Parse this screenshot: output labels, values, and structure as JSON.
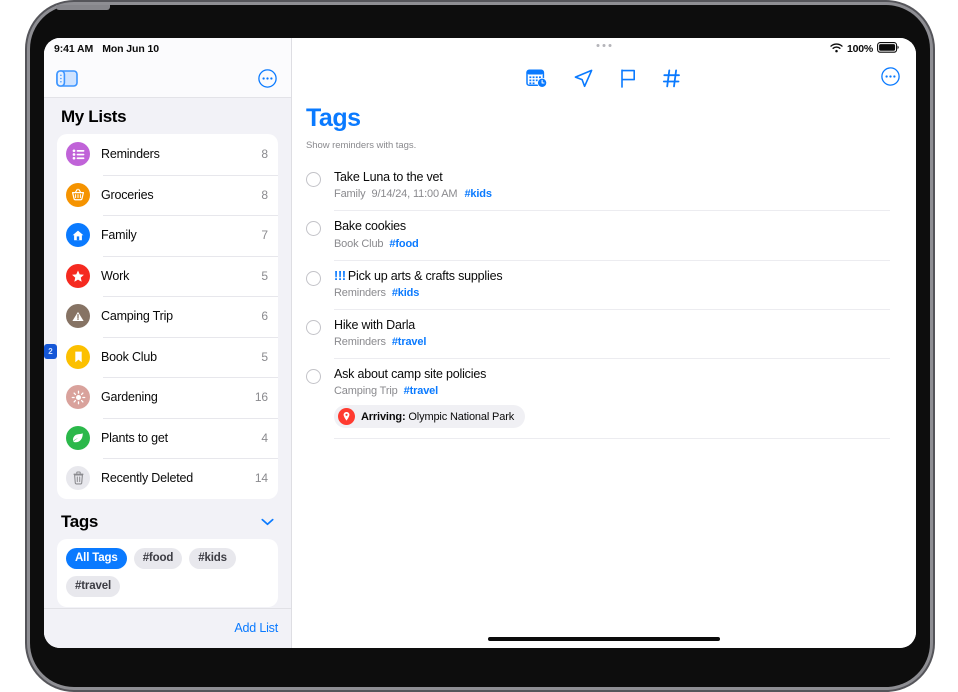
{
  "status_bar": {
    "time": "9:41 AM",
    "date": "Mon Jun 10",
    "wifi_icon": "wifi-icon",
    "battery_percent": "100%",
    "battery_icon": "battery-full-icon"
  },
  "sidebar": {
    "toggle_icon": "sidebar-toggle-icon",
    "more_icon": "more-circle-icon",
    "title": "My Lists",
    "lists": [
      {
        "label": "Reminders",
        "count": "8",
        "icon": "list-bullet-icon",
        "color": "#c063d8"
      },
      {
        "label": "Groceries",
        "count": "8",
        "icon": "basket-icon",
        "color": "#f59300"
      },
      {
        "label": "Family",
        "count": "7",
        "icon": "house-icon",
        "color": "#0a7aff"
      },
      {
        "label": "Work",
        "count": "5",
        "icon": "star-icon",
        "color": "#f52a20"
      },
      {
        "label": "Camping Trip",
        "count": "6",
        "icon": "tent-icon",
        "color": "#867364"
      },
      {
        "label": "Book Club",
        "count": "5",
        "icon": "bookmark-icon",
        "color": "#fcc000"
      },
      {
        "label": "Gardening",
        "count": "16",
        "icon": "sun-icon",
        "color": "#d9a29c"
      },
      {
        "label": "Plants to get",
        "count": "4",
        "icon": "leaf-icon",
        "color": "#2bb84a"
      },
      {
        "label": "Recently Deleted",
        "count": "14",
        "icon": "trash-icon",
        "color": "#e3e3e8"
      }
    ],
    "tags_section": {
      "title": "Tags",
      "collapse_icon": "chevron-down-icon",
      "chips": [
        {
          "label": "All Tags",
          "selected": true
        },
        {
          "label": "#food",
          "selected": false
        },
        {
          "label": "#kids",
          "selected": false
        },
        {
          "label": "#travel",
          "selected": false
        }
      ]
    },
    "add_list_label": "Add List"
  },
  "toolbar": {
    "grabber_icon": "window-grabber-icon",
    "icons": [
      {
        "name": "scheduled-calendar-icon"
      },
      {
        "name": "location-arrow-icon"
      },
      {
        "name": "flag-icon"
      },
      {
        "name": "hashtag-icon"
      }
    ],
    "more_icon": "more-circle-icon"
  },
  "main": {
    "title": "Tags",
    "subtitle": "Show reminders with tags.",
    "reminders": [
      {
        "priority": "",
        "title": "Take Luna to the vet",
        "list": "Family",
        "date": "9/14/24, 11:00 AM",
        "tag": "#kids",
        "badge": null
      },
      {
        "priority": "",
        "title": "Bake cookies",
        "list": "Book Club",
        "date": "",
        "tag": "#food",
        "badge": null
      },
      {
        "priority": "!!!",
        "title": "Pick up arts & crafts supplies",
        "list": "Reminders",
        "date": "",
        "tag": "#kids",
        "badge": null
      },
      {
        "priority": "",
        "title": "Hike with Darla",
        "list": "Reminders",
        "date": "",
        "tag": "#travel",
        "badge": null
      },
      {
        "priority": "",
        "title": "Ask about camp site policies",
        "list": "Camping Trip",
        "date": "",
        "tag": "#travel",
        "badge": {
          "icon": "location-pin-icon",
          "prefix": "Arriving:",
          "text": "Olympic National Park"
        }
      }
    ]
  },
  "annotation": {
    "marker_label": "2"
  },
  "colors": {
    "accent": "#0a7aff",
    "sidebar_bg": "#f2f2f7",
    "alert_red": "#ff3b30"
  }
}
